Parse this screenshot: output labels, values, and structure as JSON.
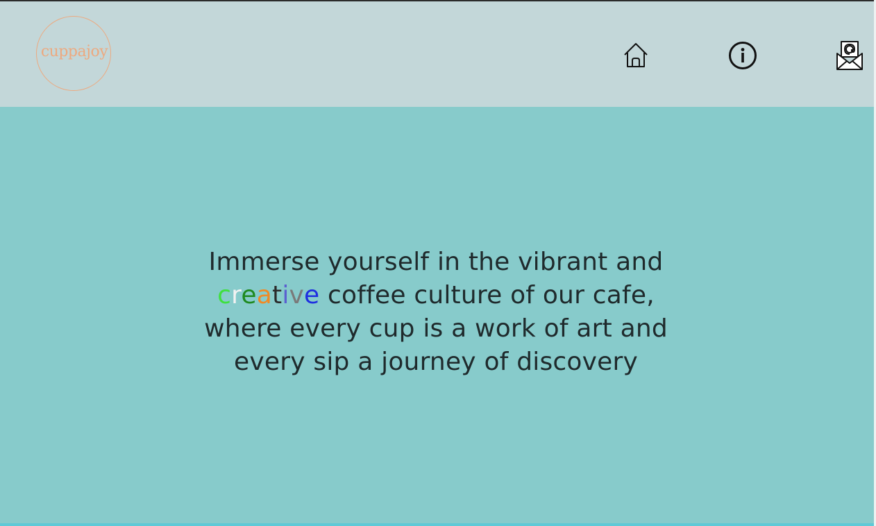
{
  "brand": {
    "logo_text": "cuppajoy",
    "logo_color": "#eda97f"
  },
  "nav": {
    "items": [
      {
        "icon": "home-icon",
        "label": "Home"
      },
      {
        "icon": "info-icon",
        "label": "About"
      },
      {
        "icon": "mail-icon",
        "label": "Contact"
      }
    ]
  },
  "hero": {
    "line1": "Immerse yourself in the vibrant and",
    "highlight_letters": [
      {
        "char": "c",
        "color": "#3fe03f"
      },
      {
        "char": "r",
        "color": "#f2f2f2"
      },
      {
        "char": "e",
        "color": "#1f8a1f"
      },
      {
        "char": "a",
        "color": "#f08a24"
      },
      {
        "char": "t",
        "color": "#2a2a2a"
      },
      {
        "char": "i",
        "color": "#5b5fd0"
      },
      {
        "char": "v",
        "color": "#7a7a7a"
      },
      {
        "char": "e",
        "color": "#1f2fe0"
      }
    ],
    "line2_rest": " coffee culture of our cafe,",
    "line3": "where every cup is a work of art and",
    "line4": "every sip a journey of discovery"
  },
  "colors": {
    "header_bg": "#c3d7d9",
    "hero_bg": "#87cbcb",
    "text": "#1f2a2c"
  }
}
